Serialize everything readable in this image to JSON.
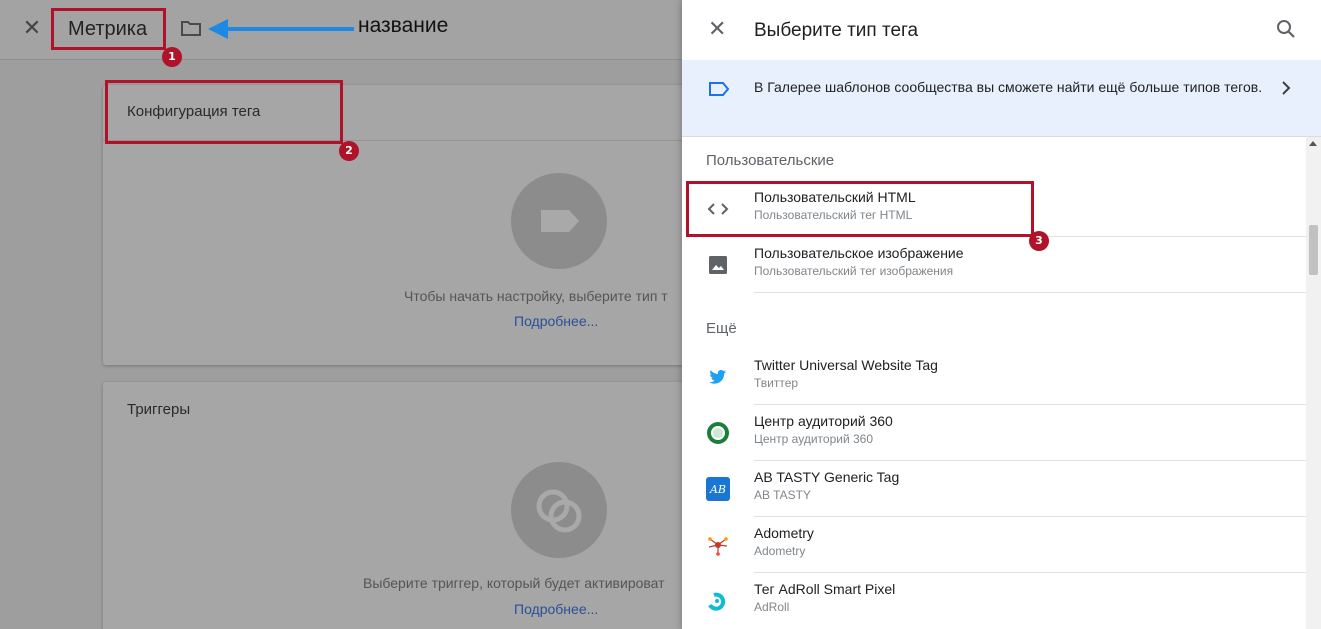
{
  "editor": {
    "close_label": "✕",
    "tag_name": "Метрика",
    "annotation_label": "название",
    "badges": [
      "1",
      "2",
      "3"
    ],
    "config_card": {
      "title": "Конфигурация тега",
      "hint": "Чтобы начать настройку, выберите тип т",
      "link": "Подробнее..."
    },
    "triggers_card": {
      "title": "Триггеры",
      "hint": "Выберите триггер, который будет активироват",
      "link": "Подробнее..."
    }
  },
  "drawer": {
    "title": "Выберите тип тега",
    "close_label": "✕",
    "banner": {
      "text": "В Галерее шаблонов сообщества вы сможете найти ещё больше типов тегов.",
      "chevron": "›"
    },
    "sections": {
      "custom": "Пользовательские",
      "more": "Ещё"
    },
    "custom_items": [
      {
        "title": "Пользовательский HTML",
        "subtitle": "Пользовательский тег HTML",
        "icon": "code-icon"
      },
      {
        "title": "Пользовательское изображение",
        "subtitle": "Пользовательский тег изображения",
        "icon": "image-icon"
      }
    ],
    "more_items": [
      {
        "title": "Twitter Universal Website Tag",
        "subtitle": "Твиттер",
        "icon": "twitter-icon"
      },
      {
        "title": "Центр аудиторий 360",
        "subtitle": "Центр аудиторий 360",
        "icon": "audience-center-icon"
      },
      {
        "title": "AB TASTY Generic Tag",
        "subtitle": "AB TASTY",
        "icon": "ab-tasty-icon"
      },
      {
        "title": "Adometry",
        "subtitle": "Adometry",
        "icon": "adometry-icon"
      },
      {
        "title": "Тег AdRoll Smart Pixel",
        "subtitle": "AdRoll",
        "icon": "adroll-icon"
      }
    ]
  },
  "colors": {
    "highlight": "#b0122a",
    "arrow": "#1e88e5",
    "banner_bg": "#e8f0fe",
    "link": "#1a73e8"
  }
}
